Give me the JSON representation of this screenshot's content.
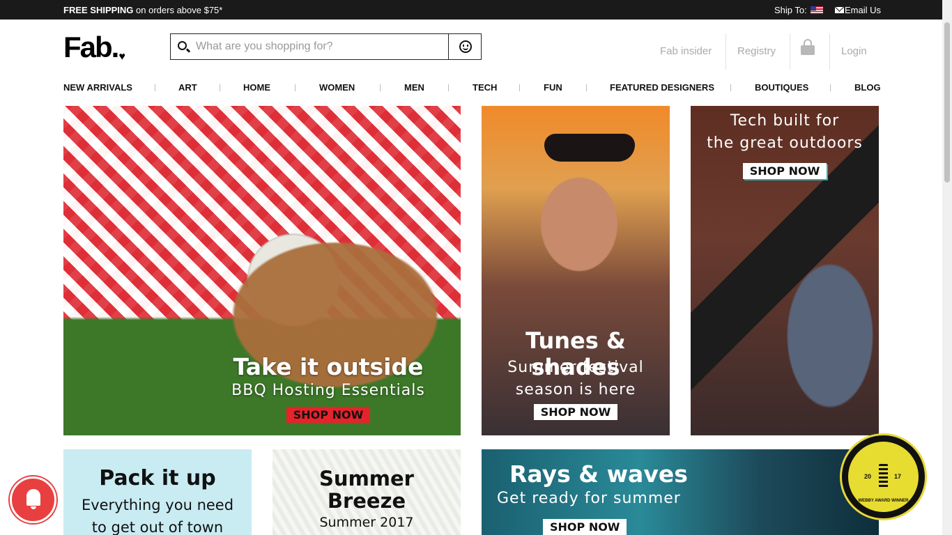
{
  "topbar": {
    "promo_bold": "FREE SHIPPING",
    "promo_rest": " on orders above $75*",
    "ship_to": "Ship To:",
    "email_us": "Email Us"
  },
  "logo": {
    "text": "Fab."
  },
  "search": {
    "placeholder": "What are you shopping for?"
  },
  "account": {
    "insider": "Fab insider",
    "registry": "Registry",
    "login": "Login"
  },
  "nav": [
    "NEW ARRIVALS",
    "ART",
    "HOME",
    "WOMEN",
    "MEN",
    "TECH",
    "FUN",
    "FEATURED DESIGNERS",
    "BOUTIQUES",
    "BLOG"
  ],
  "tiles": {
    "outside": {
      "headline": "Take it outside",
      "sub": "BBQ Hosting Essentials",
      "cta": "SHOP NOW"
    },
    "tunes": {
      "headline": "Tunes & shades",
      "sub1": "Summer festival",
      "sub2": "season is here",
      "cta": "SHOP NOW"
    },
    "tech": {
      "line1": "Tech built for",
      "line2": "the great outdoors",
      "cta": "SHOP NOW"
    },
    "pack": {
      "headline": "Pack it up",
      "sub1": "Everything you need",
      "sub2": "to get out of town"
    },
    "breeze": {
      "line1": "Summer",
      "line2": "Breeze",
      "sub": "Summer 2017"
    },
    "rays": {
      "headline": "Rays & waves",
      "sub": "Get ready for summer",
      "cta": "SHOP NOW"
    }
  },
  "webby": {
    "year_left": "20",
    "year_right": "17",
    "label": "WEBBY AWARD WINNER"
  },
  "colors": {
    "topbar": "#1a1a1a",
    "cta_red": "#e8222a",
    "bell": "#e84040",
    "webby": "#e7dc30"
  }
}
